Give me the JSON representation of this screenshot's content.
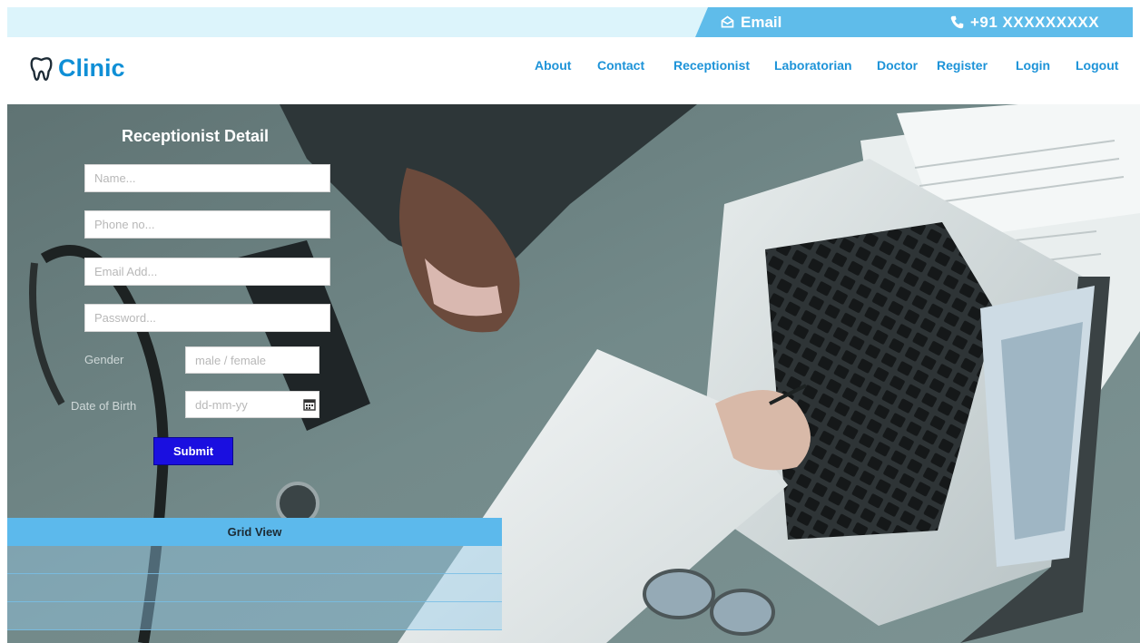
{
  "topbar": {
    "email_label": "Email",
    "phone_label": "+91 XXXXXXXXX"
  },
  "brand": {
    "name": "Clinic",
    "icon": "tooth-icon",
    "color": "#0f8fd6"
  },
  "nav": {
    "items": [
      {
        "label": "About"
      },
      {
        "label": "Contact"
      },
      {
        "label": "Receptionist"
      },
      {
        "label": "Laboratorian"
      },
      {
        "label": "Doctor"
      },
      {
        "label": "Register"
      },
      {
        "label": "Login"
      },
      {
        "label": "Logout"
      }
    ]
  },
  "form": {
    "title": "Receptionist Detail",
    "name_placeholder": "Name...",
    "phone_placeholder": "Phone no...",
    "email_placeholder": "Email Add...",
    "password_placeholder": "Password...",
    "gender_label": "Gender",
    "gender_placeholder": "male / female",
    "dob_label": "Date of Birth",
    "dob_placeholder": "dd-mm-yy",
    "submit_label": "Submit"
  },
  "grid": {
    "header": "Grid View",
    "rows": [
      "",
      "",
      ""
    ]
  },
  "colors": {
    "accent": "#5fbcea",
    "topbar_bg": "#dcf4fb",
    "submit_bg": "#1a0fe0",
    "nav_link": "#1d93d8"
  }
}
